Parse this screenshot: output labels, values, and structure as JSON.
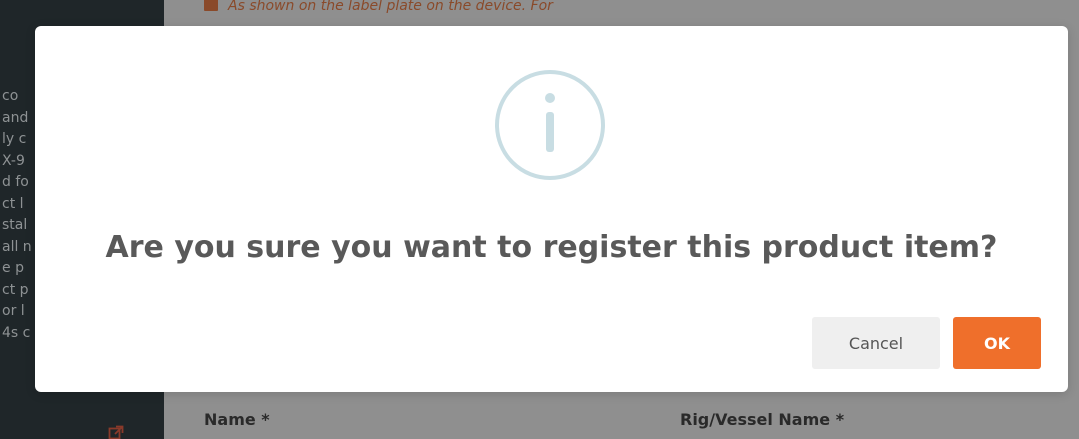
{
  "background": {
    "sidebar_lines": [
      "co",
      "and",
      "ly c",
      "X-9",
      "d fo",
      "ct l",
      "stal",
      "all n",
      "e p",
      "ct p",
      "or l",
      "4s c"
    ],
    "note": "As shown on the label plate on the device. For",
    "note_line2": "...",
    "fields": {
      "name_label": "Name *",
      "rig_label": "Rig/Vessel Name *"
    }
  },
  "dialog": {
    "icon": "info-icon",
    "message": "Are you sure you want to register this product item?",
    "cancel_label": "Cancel",
    "ok_label": "OK"
  },
  "colors": {
    "accent": "#ef6f2b",
    "icon_ring": "#c8dde3",
    "title_text": "#595959"
  }
}
